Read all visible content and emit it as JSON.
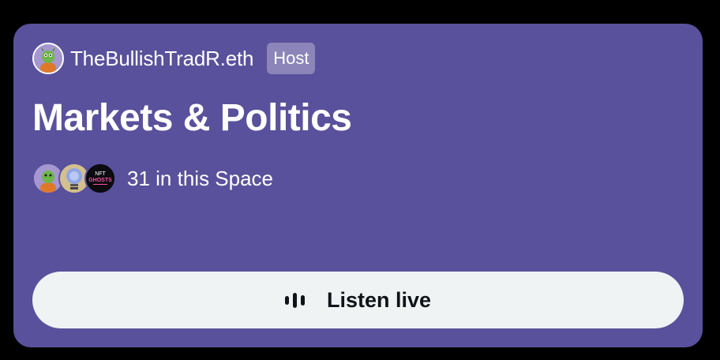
{
  "space_card": {
    "host": {
      "name": "TheBullishTradR.eth",
      "badge": "Host",
      "avatar_icon": "dragon-avatar-icon"
    },
    "title": "Markets & Politics",
    "listeners": {
      "count_text": "31 in this Space",
      "avatars": [
        {
          "icon": "dragon-avatar-icon"
        },
        {
          "icon": "lightbulb-avatar-icon"
        },
        {
          "icon": "nft-ghosts-avatar-icon",
          "text": "NFT GHOSTS"
        }
      ]
    },
    "listen_button": {
      "label": "Listen live",
      "icon": "audio-bars-icon"
    }
  },
  "colors": {
    "card_background": "#59519B",
    "button_background": "#EFF3F4",
    "button_text": "#0F1419",
    "page_background": "#000000"
  }
}
